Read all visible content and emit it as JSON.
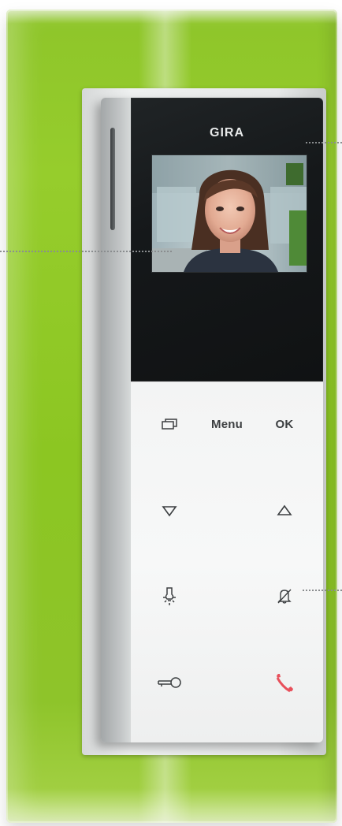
{
  "device": {
    "brand": "GIRA",
    "keys": {
      "menu_label": "Menu",
      "ok_label": "OK"
    },
    "icons": [
      "screens-icon",
      "arrow-down-icon",
      "arrow-up-icon",
      "light-bulb-icon",
      "bell-mute-icon",
      "key-icon",
      "handset-icon"
    ],
    "colors": {
      "frame_green": "#8ec52a",
      "screen_black": "#15181a",
      "keypad_white": "#f3f4f4",
      "handset_red": "#e8505b"
    }
  }
}
